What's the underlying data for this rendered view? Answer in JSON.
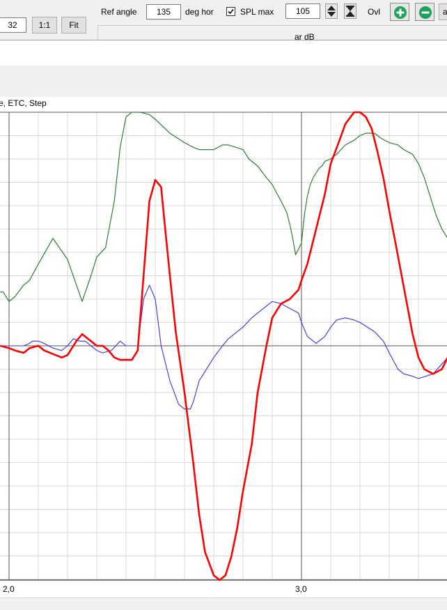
{
  "toolbar": {
    "zoom_value": "32",
    "one_to_one_label": "1:1",
    "fit_label": "Fit",
    "ref_angle_label": "Ref angle",
    "ref_angle_value": "135",
    "deg_hor_label": "deg hor",
    "spl_max_checked": true,
    "spl_max_label": "SPL max",
    "spl_max_value": "105",
    "ovl_label": "Ovl",
    "cut_text_1": "ar dB",
    "cut_text_2": "a"
  },
  "chart": {
    "title": "e, ETC, Step"
  },
  "colors": {
    "step_red": "#ff0000",
    "impulse_blue": "#3333ff",
    "etc_green": "#2e7d32",
    "grid_minor": "#d9d9d9",
    "grid_major": "#555555",
    "plus_minus_green": "#1ba35a"
  },
  "chart_data": {
    "type": "line",
    "title": "e, ETC, Step",
    "xlabel": "",
    "ylabel": "",
    "x_ticks": [
      "2,0",
      "3,0"
    ],
    "xlim": [
      1.97,
      3.5
    ],
    "grid": true,
    "series": [
      {
        "color": "#2e7d32",
        "x": [
          1.97,
          1.98,
          2.0,
          2.02,
          2.05,
          2.07,
          2.1,
          2.15,
          2.2,
          2.25,
          2.28,
          2.3,
          2.33,
          2.36,
          2.38,
          2.4,
          2.42,
          2.45,
          2.48,
          2.5,
          2.55,
          2.6,
          2.63,
          2.65,
          2.7,
          2.73,
          2.75,
          2.8,
          2.82,
          2.85,
          2.88,
          2.9,
          2.93,
          2.95,
          2.96,
          2.97,
          2.98,
          3.0,
          3.01,
          3.02,
          3.03,
          3.04,
          3.05,
          3.06,
          3.07,
          3.08,
          3.1,
          3.12,
          3.15,
          3.18,
          3.2,
          3.22,
          3.25,
          3.27,
          3.3,
          3.33,
          3.35,
          3.38,
          3.4,
          3.42,
          3.44,
          3.46,
          3.48,
          3.5
        ],
        "y": [
          0.23,
          0.23,
          0.19,
          0.21,
          0.26,
          0.28,
          0.35,
          0.46,
          0.37,
          0.19,
          0.3,
          0.38,
          0.42,
          0.62,
          0.85,
          0.98,
          1.0,
          1.0,
          0.99,
          0.97,
          0.91,
          0.87,
          0.85,
          0.84,
          0.84,
          0.86,
          0.86,
          0.84,
          0.8,
          0.77,
          0.72,
          0.69,
          0.62,
          0.57,
          0.52,
          0.46,
          0.39,
          0.44,
          0.56,
          0.64,
          0.69,
          0.72,
          0.74,
          0.76,
          0.77,
          0.79,
          0.8,
          0.82,
          0.86,
          0.88,
          0.9,
          0.91,
          0.91,
          0.89,
          0.87,
          0.86,
          0.84,
          0.82,
          0.78,
          0.72,
          0.64,
          0.56,
          0.5,
          0.46
        ]
      },
      {
        "color": "#3333ff",
        "x": [
          1.97,
          2.0,
          2.02,
          2.05,
          2.07,
          2.08,
          2.1,
          2.12,
          2.15,
          2.18,
          2.2,
          2.22,
          2.24,
          2.26,
          2.3,
          2.32,
          2.35,
          2.38,
          2.4,
          2.42,
          2.44,
          2.46,
          2.48,
          2.5,
          2.52,
          2.55,
          2.58,
          2.6,
          2.62,
          2.63,
          2.65,
          2.7,
          2.73,
          2.75,
          2.78,
          2.8,
          2.83,
          2.85,
          2.88,
          2.9,
          2.93,
          2.96,
          2.99,
          3.0,
          3.02,
          3.05,
          3.08,
          3.1,
          3.12,
          3.15,
          3.18,
          3.2,
          3.25,
          3.28,
          3.3,
          3.33,
          3.35,
          3.38,
          3.4,
          3.45,
          3.5
        ],
        "y": [
          0.0,
          0.0,
          0.0,
          0.0,
          0.01,
          0.02,
          0.02,
          0.01,
          -0.01,
          -0.02,
          0.0,
          0.03,
          0.02,
          0.02,
          -0.02,
          -0.03,
          -0.02,
          0.02,
          0.0,
          0.0,
          0.0,
          0.2,
          0.26,
          0.2,
          0.0,
          -0.15,
          -0.25,
          -0.27,
          -0.27,
          -0.24,
          -0.15,
          -0.05,
          0.0,
          0.03,
          0.06,
          0.08,
          0.12,
          0.14,
          0.17,
          0.19,
          0.18,
          0.16,
          0.14,
          0.1,
          0.04,
          0.01,
          0.04,
          0.08,
          0.11,
          0.12,
          0.11,
          0.1,
          0.06,
          0.02,
          -0.03,
          -0.1,
          -0.12,
          -0.13,
          -0.14,
          -0.12,
          -0.05
        ]
      },
      {
        "color": "#ff0000",
        "x": [
          1.97,
          2.0,
          2.02,
          2.05,
          2.07,
          2.1,
          2.12,
          2.14,
          2.16,
          2.18,
          2.2,
          2.23,
          2.25,
          2.28,
          2.3,
          2.32,
          2.34,
          2.36,
          2.38,
          2.4,
          2.42,
          2.44,
          2.46,
          2.48,
          2.5,
          2.52,
          2.53,
          2.55,
          2.57,
          2.6,
          2.63,
          2.65,
          2.67,
          2.7,
          2.72,
          2.74,
          2.76,
          2.78,
          2.8,
          2.83,
          2.85,
          2.88,
          2.9,
          2.93,
          2.96,
          2.99,
          3.0,
          3.02,
          3.05,
          3.08,
          3.1,
          3.13,
          3.15,
          3.18,
          3.2,
          3.22,
          3.24,
          3.26,
          3.28,
          3.3,
          3.32,
          3.35,
          3.38,
          3.4,
          3.42,
          3.45,
          3.48,
          3.5
        ],
        "y": [
          0.0,
          -0.01,
          -0.02,
          -0.03,
          -0.01,
          0.0,
          -0.02,
          -0.03,
          -0.04,
          -0.05,
          -0.04,
          0.02,
          0.05,
          0.02,
          0.0,
          0.0,
          -0.02,
          -0.05,
          -0.06,
          -0.06,
          -0.06,
          -0.02,
          0.3,
          0.62,
          0.71,
          0.68,
          0.55,
          0.3,
          0.06,
          -0.2,
          -0.5,
          -0.72,
          -0.88,
          -0.98,
          -1.0,
          -0.98,
          -0.9,
          -0.78,
          -0.62,
          -0.42,
          -0.2,
          0.0,
          0.12,
          0.18,
          0.2,
          0.24,
          0.28,
          0.35,
          0.5,
          0.65,
          0.78,
          0.88,
          0.95,
          1.0,
          1.0,
          0.98,
          0.93,
          0.83,
          0.72,
          0.58,
          0.45,
          0.25,
          0.05,
          -0.05,
          -0.1,
          -0.12,
          -0.1,
          -0.05
        ]
      }
    ]
  }
}
